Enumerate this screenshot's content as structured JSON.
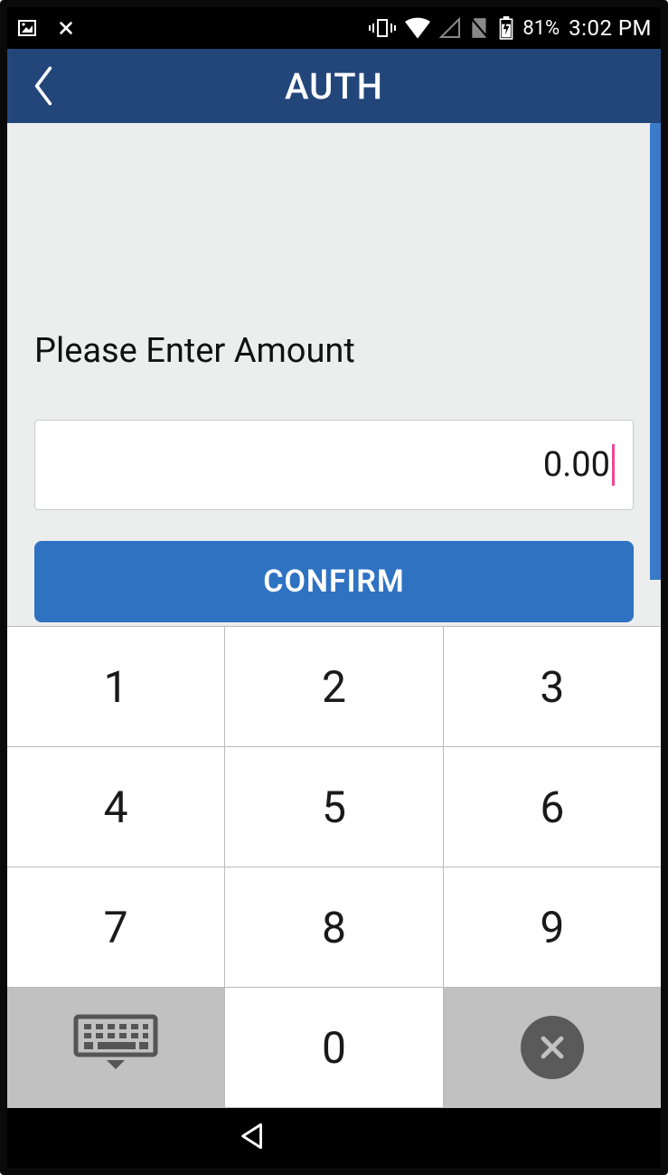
{
  "statusbar": {
    "battery_percent": "81%",
    "time": "3:02 PM"
  },
  "header": {
    "title": "AUTH"
  },
  "content": {
    "prompt": "Please Enter Amount",
    "amount_value": "0.00",
    "confirm_label": "CONFIRM"
  },
  "keypad": {
    "k1": "1",
    "k2": "2",
    "k3": "3",
    "k4": "4",
    "k5": "5",
    "k6": "6",
    "k7": "7",
    "k8": "8",
    "k9": "9",
    "k0": "0"
  }
}
